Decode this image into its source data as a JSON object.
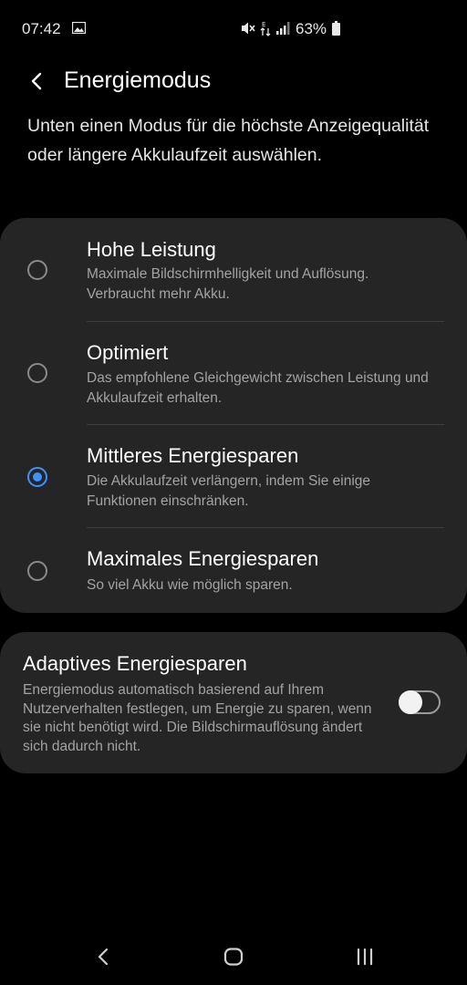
{
  "status_bar": {
    "time": "07:42",
    "battery_percent": "63%",
    "icons": [
      "image-icon",
      "mute-icon",
      "data-e-icon",
      "signal-icon",
      "battery-icon"
    ]
  },
  "header": {
    "title": "Energiemodus",
    "back_icon": "chevron-left-icon"
  },
  "description": "Unten einen Modus für die höchste Anzeigequalität oder längere Akkulaufzeit auswählen.",
  "modes": [
    {
      "title": "Hohe Leistung",
      "description": "Maximale Bildschirmhelligkeit und Auflösung. Verbraucht mehr Akku.",
      "selected": false
    },
    {
      "title": "Optimiert",
      "description": "Das empfohlene Gleichgewicht zwischen Leistung und Akkulaufzeit erhalten.",
      "selected": false
    },
    {
      "title": "Mittleres Energiesparen",
      "description": "Die Akkulaufzeit verlängern, indem Sie einige Funktionen einschränken.",
      "selected": true
    },
    {
      "title": "Maximales Energiesparen",
      "description": "So viel Akku wie möglich sparen.",
      "selected": false
    }
  ],
  "adaptive": {
    "title": "Adaptives Energiesparen",
    "description": "Energiemodus automatisch basierend auf Ihrem Nutzerverhalten festlegen, um Energie zu sparen, wenn sie nicht benötigt wird. Die Bildschirmauflösung ändert sich dadurch nicht.",
    "enabled": false
  },
  "nav_bar": {
    "icons": [
      "nav-back-icon",
      "nav-home-icon",
      "nav-recents-icon"
    ]
  },
  "colors": {
    "background": "#000000",
    "card": "#252525",
    "accent": "#3e91ff",
    "secondary_text": "#a3a3a3"
  }
}
